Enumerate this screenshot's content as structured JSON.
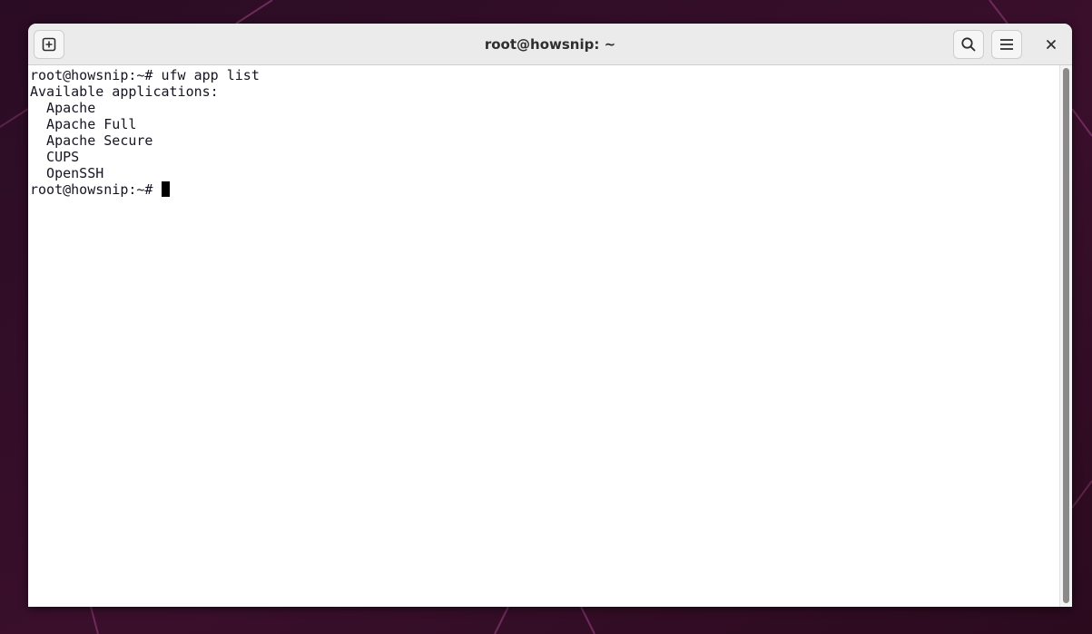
{
  "window": {
    "title": "root@howsnip: ~"
  },
  "icons": {
    "new_tab": "new-tab-icon",
    "search": "search-icon",
    "menu": "hamburger-menu-icon",
    "close": "close-icon"
  },
  "terminal": {
    "lines": [
      "root@howsnip:~# ufw app list",
      "Available applications:",
      "  Apache",
      "  Apache Full",
      "  Apache Secure",
      "  CUPS",
      "  OpenSSH"
    ],
    "prompt": "root@howsnip:~# "
  },
  "colors": {
    "desktop_background": "#2c0a20",
    "titlebar": "#ebebeb",
    "terminal_background": "#ffffff",
    "terminal_text": "#171421"
  }
}
